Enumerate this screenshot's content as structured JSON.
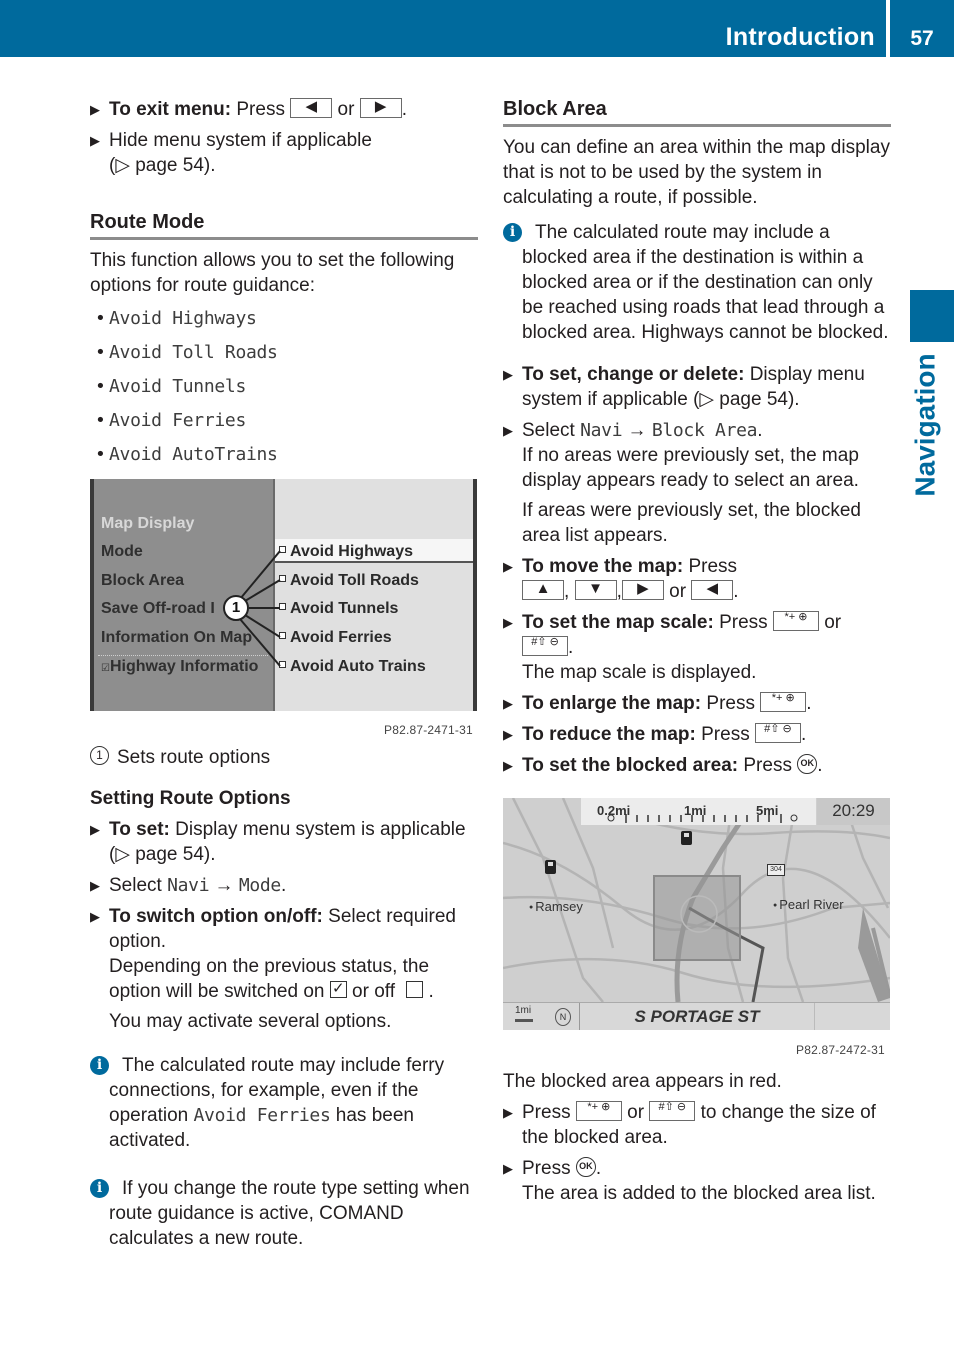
{
  "header": {
    "section_title": "Introduction",
    "page_number": "57"
  },
  "side_tab": {
    "label": "Navigation"
  },
  "colors": {
    "brand_blue": "#006a9d",
    "rule_gray": "#8c8c8c"
  },
  "left": {
    "exit_menu": {
      "bold": "To exit menu:",
      "text": " Press ",
      "key1": "◀",
      "or": " or ",
      "key2": "▶",
      "end": "."
    },
    "hide_menu": {
      "text": "Hide menu system if applicable",
      "ref": "(▷ page 54)."
    },
    "route_mode": {
      "heading": "Route Mode",
      "intro": "This function allows you to set the following options for route guidance:",
      "options": [
        "Avoid Highways",
        "Avoid Toll Roads",
        "Avoid Tunnels",
        "Avoid Ferries",
        "Avoid AutoTrains"
      ]
    },
    "figure1": {
      "menu_left": [
        "Map Display",
        "Mode",
        "Block Area",
        "Save Off-road I",
        "Information On Map",
        "Highway Informatio"
      ],
      "menu_right": [
        "Avoid Highways",
        "Avoid Toll Roads",
        "Avoid Tunnels",
        "Avoid Ferries",
        "Avoid Auto Trains"
      ],
      "callout": "1",
      "code": "P82.87-2471-31"
    },
    "legend": {
      "num": "1",
      "text": "Sets route options"
    },
    "setting": {
      "heading": "Setting Route Options",
      "to_set_bold": "To set:",
      "to_set_text": " Display menu system is applicable",
      "to_set_ref": "(▷ page 54).",
      "select_prefix": "Select ",
      "select_path1": "Navi",
      "arrow": " → ",
      "select_path2": "Mode",
      "select_end": ".",
      "switch_bold": "To switch option on/off:",
      "switch_text": " Select required option.",
      "switch_line2": "Depending on the previous status, the option will be switched on ",
      "on_glyph": "✓",
      "or_off": " or off ",
      "switch_end": " .",
      "several": "You may activate several options."
    },
    "info1": {
      "icon": "i",
      "text1": "The calculated route may include ferry connections, for example, even if the operation ",
      "mono": "Avoid Ferries",
      "text2": " has been activated."
    },
    "info2": {
      "icon": "i",
      "text": "If you change the route type setting when route guidance is active, COMAND calculates a new route."
    }
  },
  "right": {
    "block_area": {
      "heading": "Block Area",
      "intro": "You can define an area within the map display that is not to be used by the system in calculating a route, if possible.",
      "info_icon": "i",
      "info": "The calculated route may include a blocked area if the destination is within a blocked area or if the destination can only be reached using roads that lead through a blocked area. Highways cannot be blocked."
    },
    "steps": {
      "set_change_bold": "To set, change or delete:",
      "set_change_text": " Display menu system if applicable (▷ page 54).",
      "select_prefix": "Select ",
      "select_path1": "Navi",
      "arrow": " → ",
      "select_path2": "Block Area",
      "select_end": ".",
      "no_areas": "If no areas were previously set, the map display appears ready to select an area.",
      "areas_set": "If areas were previously set, the blocked area list appears.",
      "move_bold": "To move the map:",
      "move_text": " Press",
      "keys_move": [
        "▲",
        "▼",
        "▶",
        "◀"
      ],
      "comma": ",",
      "or": " or ",
      "dot": ".",
      "scale_bold": "To set the map scale:",
      "scale_text": " Press ",
      "zoom_in_key": "*+ ⊕",
      "zoom_out_key": "#⇧ ⊖",
      "scale_shown": "The map scale is displayed.",
      "enlarge_bold": "To enlarge the map:",
      "enlarge_text": " Press ",
      "reduce_bold": "To reduce the map:",
      "reduce_text": " Press ",
      "blocked_bold": "To set the blocked area:",
      "blocked_text": " Press ",
      "ok_key": "OK"
    },
    "figure2": {
      "scale_labels": [
        "0.2mi",
        "1mi",
        "5mi"
      ],
      "time": "20:29",
      "places": [
        "Ramsey",
        "Pearl River"
      ],
      "route_sign": "304",
      "scale_unit": "1mi",
      "compass": "N",
      "street": "S PORTAGE ST",
      "code": "P82.87-2472-31"
    },
    "after": {
      "red_text": "The blocked area appears in red.",
      "press": "Press ",
      "or": " or ",
      "size_text": " to change the size of the blocked area.",
      "press_ok": "Press ",
      "added": "The area is added to the blocked area list."
    }
  }
}
